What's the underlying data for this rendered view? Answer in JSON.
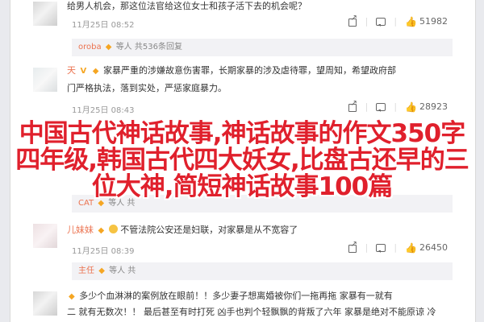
{
  "comments": [
    {
      "name": "",
      "text": "给男人机会，那这位法官给这位女士和孩子活下去的机会呢？",
      "time": "11月25日 08:52",
      "share": "",
      "comment_count": "",
      "likes": "51982"
    },
    {
      "reply_name": "oroba",
      "reply_text": "等人 共536条回复",
      "name": "",
      "name_suffix": "天",
      "text1": "家暴严重的涉嫌故意伤害罪，长期家暴的涉及虐待罪，望周知，希望政府部",
      "text2": "门严格执法，落到实处，严惩家庭暴力。",
      "time": "11月25日 08:43",
      "likes": "28923"
    },
    {
      "reply_name": "CAT",
      "reply_text": "等人 共",
      "name": "儿妹妹",
      "text": "不管法院公安还是妇联，对家暴是从不宽容了",
      "time": "11月25日 08:39",
      "likes": "26450"
    },
    {
      "reply_name": "主任",
      "reply_text": "等人 共",
      "name": "",
      "text1": "多少个血淋淋的案例放在眼前！！多少妻子想离婚被你们一拖再拖 家暴有一就有",
      "text2": "二 就有无数次！！ 最后甚至有时打死 凶手也判个轻飘飘的背叛了六年 家暴是绝对不能原谅 冷"
    }
  ],
  "overlay": {
    "line1": "中国古代神话故事,神话故事的作文350字",
    "line2": "四年级,韩国古代四大妖女,比盘古还早的三",
    "line3": "位大神,简短神话故事100篇"
  },
  "colors": {
    "username": "#eb7350",
    "overlay": "#e0202c"
  }
}
